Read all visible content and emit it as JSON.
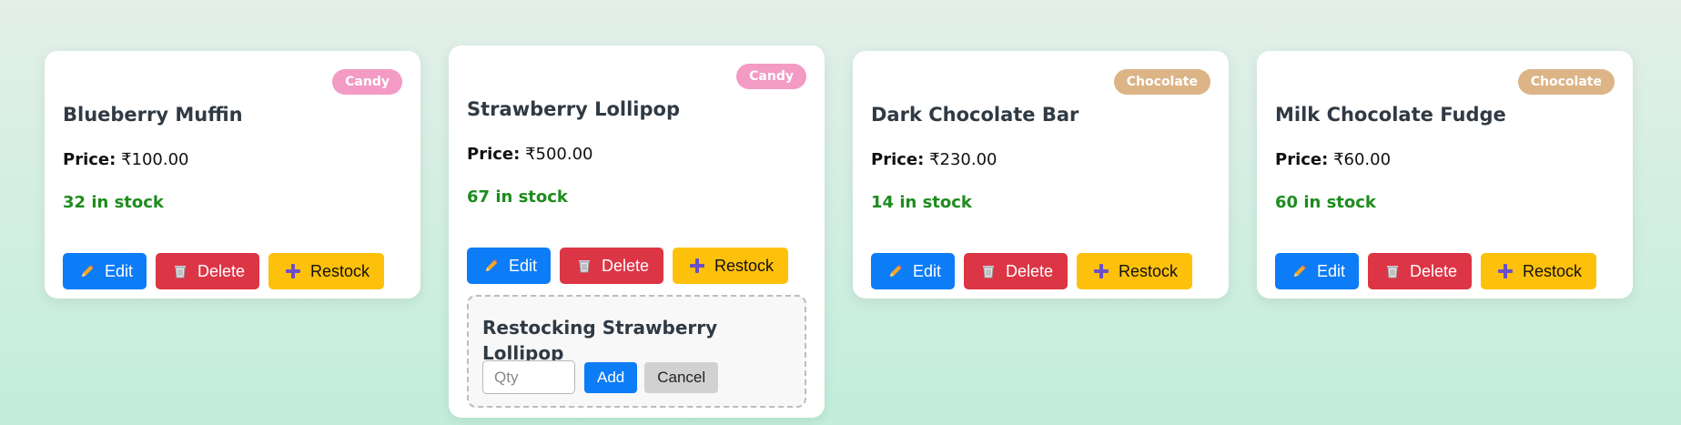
{
  "colors": {
    "candy_badge": "#f39ac5",
    "chocolate_badge": "#dcb486",
    "edit": "#0d7cf7",
    "delete": "#dc3545",
    "restock": "#fec10b",
    "stock_text": "#1e8c1e"
  },
  "icons": {
    "edit": "pencil-icon",
    "delete": "trash-icon",
    "restock": "plus-icon"
  },
  "products": [
    {
      "name": "Blueberry Muffin",
      "category": "Candy",
      "price_label": "Price:",
      "price": "₹100.00",
      "stock": "32 in stock",
      "edit": "Edit",
      "delete": "Delete",
      "restock": "Restock"
    },
    {
      "name": "Strawberry Lollipop",
      "category": "Candy",
      "price_label": "Price:",
      "price": "₹500.00",
      "stock": "67 in stock",
      "edit": "Edit",
      "delete": "Delete",
      "restock": "Restock"
    },
    {
      "name": "Dark Chocolate Bar",
      "category": "Chocolate",
      "price_label": "Price:",
      "price": "₹230.00",
      "stock": "14 in stock",
      "edit": "Edit",
      "delete": "Delete",
      "restock": "Restock"
    },
    {
      "name": "Milk Chocolate Fudge",
      "category": "Chocolate",
      "price_label": "Price:",
      "price": "₹60.00",
      "stock": "60 in stock",
      "edit": "Edit",
      "delete": "Delete",
      "restock": "Restock"
    }
  ],
  "restock_panel": {
    "prefix": "Restocking",
    "product": "Strawberry Lollipop",
    "qty_placeholder": "Qty",
    "add": "Add",
    "cancel": "Cancel"
  }
}
